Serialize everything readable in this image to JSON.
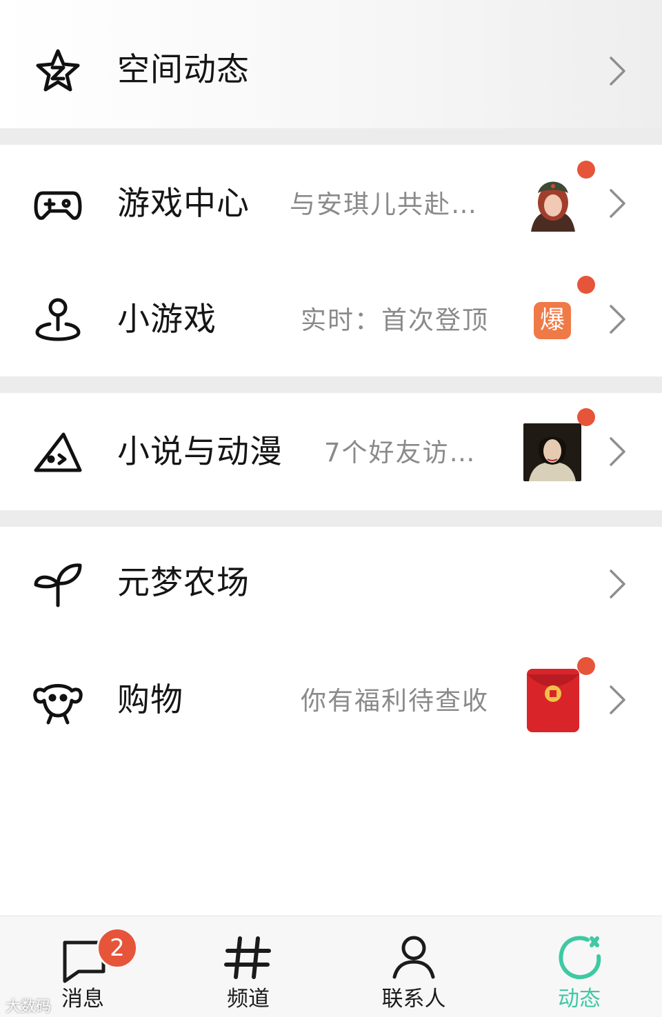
{
  "items": [
    {
      "title": "空间动态",
      "subtitle": "",
      "icon": "star-z-icon"
    },
    {
      "title": "游戏中心",
      "subtitle": "与安琪儿共赴…",
      "icon": "gamepad-icon",
      "thumb": "game-avatar",
      "has_dot": true
    },
    {
      "title": "小游戏",
      "subtitle": "实时：首次登顶",
      "icon": "map-pin-icon",
      "badge": "爆",
      "has_dot": true
    },
    {
      "title": "小说与动漫",
      "subtitle": "7个好友访…",
      "icon": "cheese-icon",
      "thumb": "novel-portrait",
      "has_dot": true
    },
    {
      "title": "元梦农场",
      "subtitle": "",
      "icon": "sprout-icon"
    },
    {
      "title": "购物",
      "subtitle": "你有福利待查收",
      "icon": "dog-face-icon",
      "thumb": "red-envelope",
      "has_dot": true
    }
  ],
  "tabs": [
    {
      "label": "消息",
      "icon": "chat-bubble-icon",
      "badge": "2",
      "active": false
    },
    {
      "label": "频道",
      "icon": "hash-icon",
      "active": false
    },
    {
      "label": "联系人",
      "icon": "person-icon",
      "active": false
    },
    {
      "label": "动态",
      "icon": "refresh-star-icon",
      "active": true
    }
  ],
  "watermark": "大数码",
  "colors": {
    "accent": "#3fc9a3",
    "badge_red": "#e6543a",
    "hot_orange": "#ef7a47",
    "subtitle_gray": "#8a8a8a"
  }
}
